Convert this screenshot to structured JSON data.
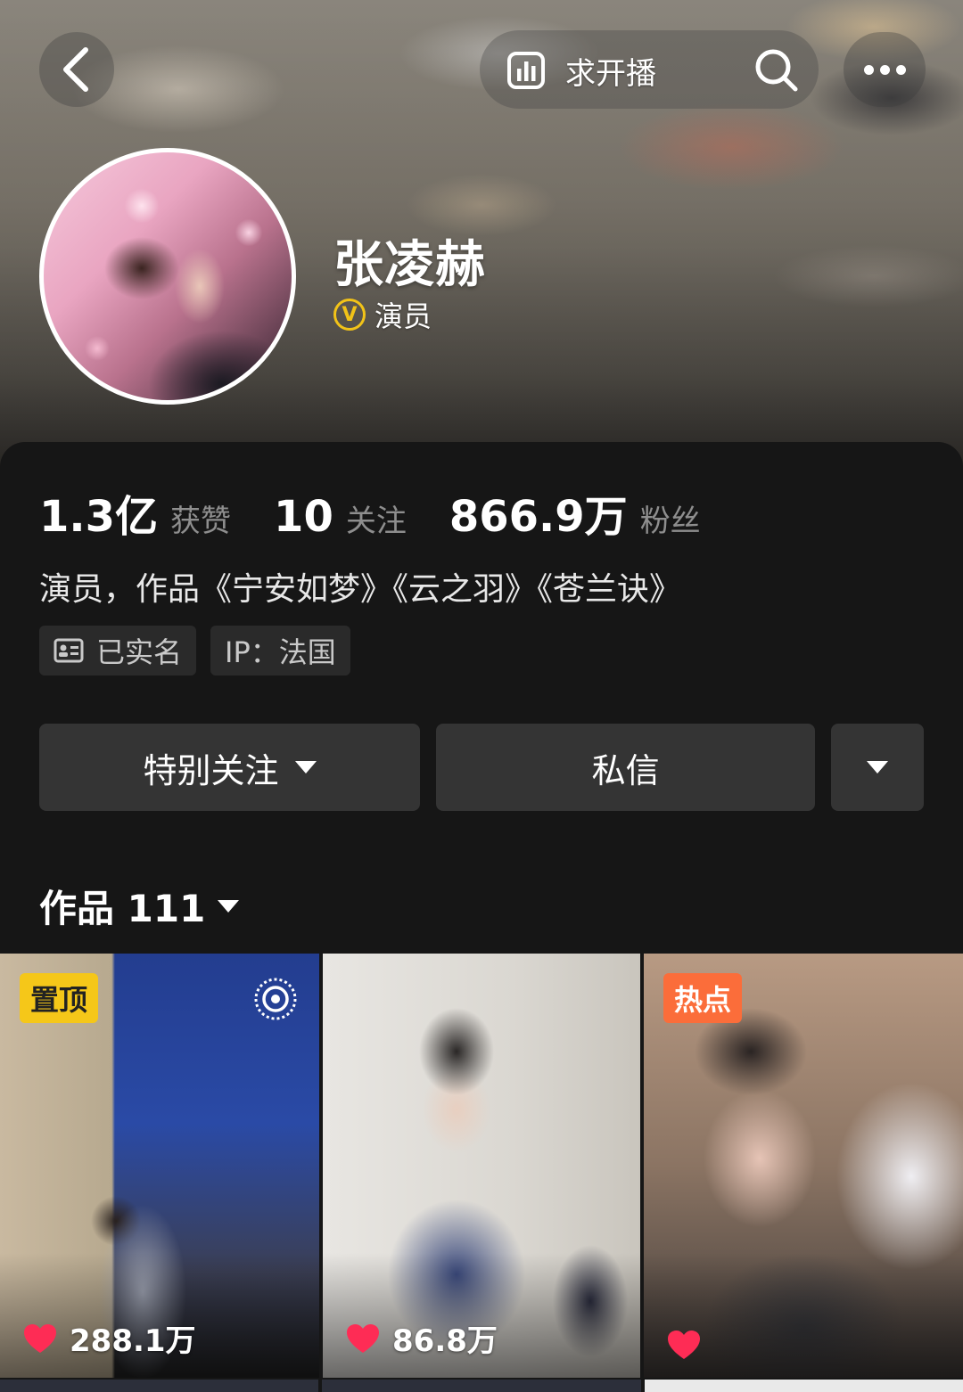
{
  "header": {
    "live_label": "求开播",
    "back_icon": "chevron-left-icon",
    "live_icon": "bar-chart-icon",
    "search_icon": "search-icon",
    "more_icon": "more-dots-icon"
  },
  "profile": {
    "name": "张凌赫",
    "verify_badge": "V",
    "verify_text": "演员",
    "verify_color": "#f2c318"
  },
  "stats": [
    {
      "value": "1.3亿",
      "label": "获赞"
    },
    {
      "value": "10",
      "label": "关注"
    },
    {
      "value": "866.9万",
      "label": "粉丝"
    }
  ],
  "bio": "演员，作品《宁安如梦》《云之羽》《苍兰诀》",
  "tags": {
    "real_name": "已实名",
    "ip": "IP：法国"
  },
  "actions": {
    "follow": "特别关注",
    "message": "私信"
  },
  "works": {
    "label": "作品 111"
  },
  "videos": [
    {
      "badge": "置顶",
      "likes": "288.1万"
    },
    {
      "badge": "",
      "likes": "86.8万"
    },
    {
      "badge": "热点",
      "likes": ""
    }
  ],
  "colors": {
    "background": "#161616",
    "button": "#343434",
    "pin_badge": "#f5c719",
    "hot_badge": "#fb6d3a",
    "heart": "#fe2c55"
  }
}
